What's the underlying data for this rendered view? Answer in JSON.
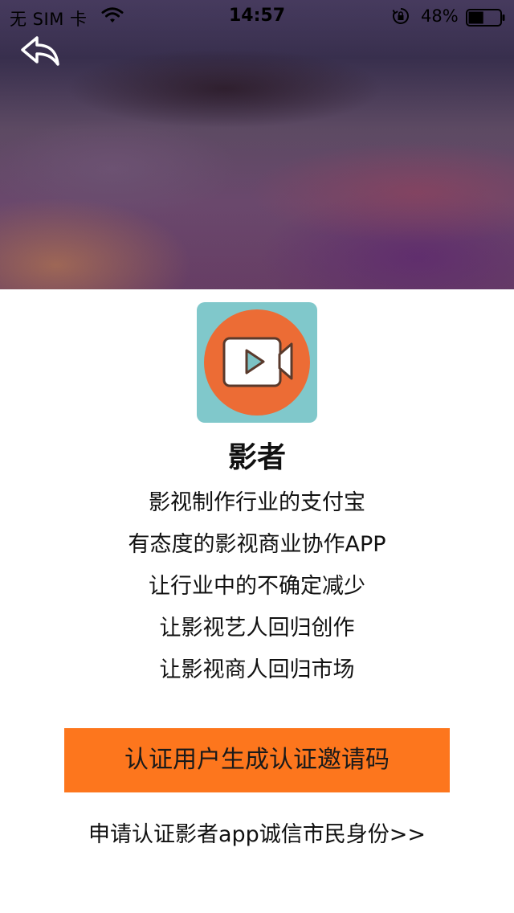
{
  "status_bar": {
    "carrier": "无 SIM 卡",
    "time": "14:57",
    "battery": "48%",
    "battery_level": 0.48
  },
  "header": {
    "back_icon": "back-arrow-icon"
  },
  "app": {
    "name": "影者",
    "icon": "video-camera-play-icon",
    "colors": {
      "icon_background": "#80c8cb",
      "icon_circle": "#ec6c35"
    }
  },
  "slogans": [
    "影视制作行业的支付宝",
    "有态度的影视商业协作APP",
    "让行业中的不确定减少",
    "让影视艺人回归创作",
    "让影视商人回归市场"
  ],
  "actions": {
    "primary_button": "认证用户生成认证邀请码",
    "apply_link": "申请认证影者app诚信市民身份>>",
    "colors": {
      "primary": "#fd761d"
    }
  }
}
